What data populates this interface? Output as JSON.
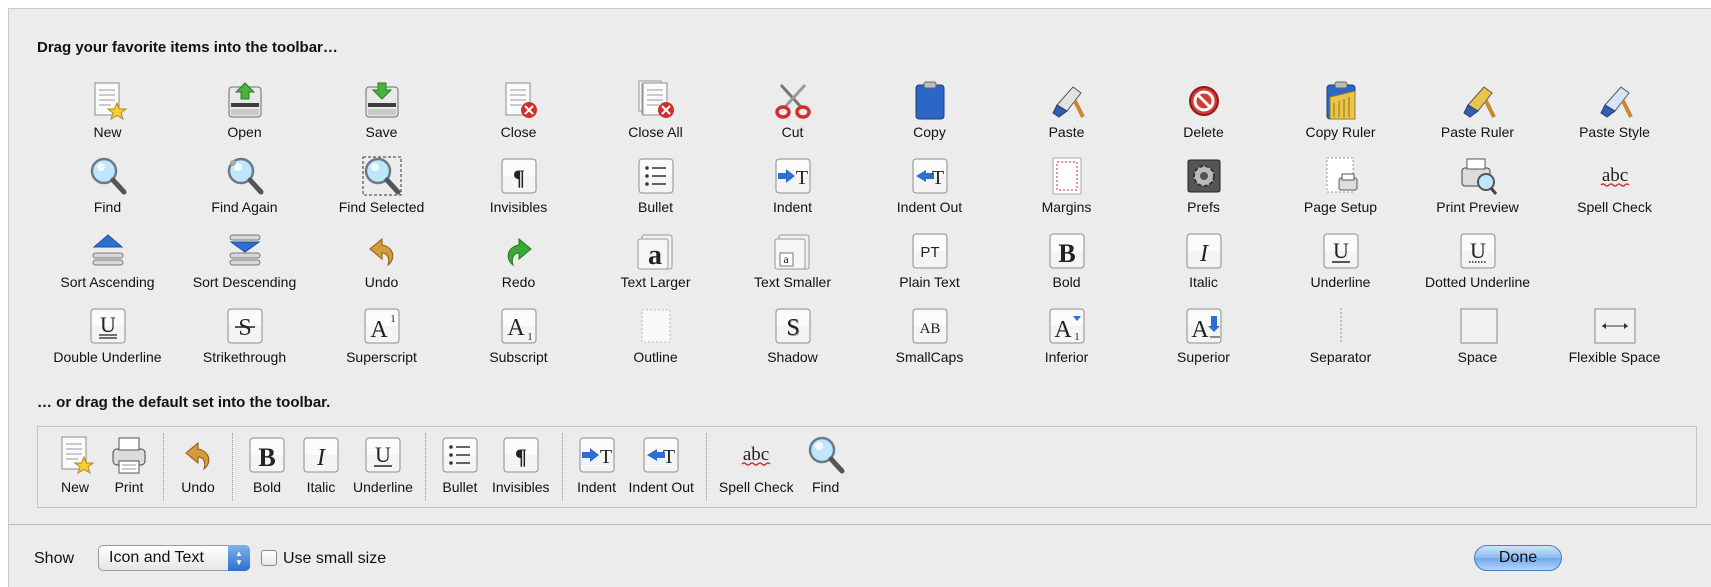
{
  "window": {
    "heading_items": "Drag your favorite items into the toolbar…",
    "heading_default": "… or drag the default set into the toolbar."
  },
  "items": [
    {
      "label": "New",
      "icon": "new-doc-icon"
    },
    {
      "label": "Open",
      "icon": "open-tray-icon"
    },
    {
      "label": "Save",
      "icon": "save-tray-icon"
    },
    {
      "label": "Close",
      "icon": "close-doc-icon"
    },
    {
      "label": "Close All",
      "icon": "close-all-icon"
    },
    {
      "label": "Cut",
      "icon": "scissors-icon"
    },
    {
      "label": "Copy",
      "icon": "clipboard-icon"
    },
    {
      "label": "Paste",
      "icon": "paste-brush-icon"
    },
    {
      "label": "Delete",
      "icon": "delete-icon"
    },
    {
      "label": "Copy Ruler",
      "icon": "copy-ruler-icon"
    },
    {
      "label": "Paste Ruler",
      "icon": "paste-ruler-icon"
    },
    {
      "label": "Paste Style",
      "icon": "paste-style-icon"
    },
    {
      "label": "Find",
      "icon": "magnifier-icon"
    },
    {
      "label": "Find Again",
      "icon": "find-again-icon"
    },
    {
      "label": "Find Selected",
      "icon": "find-selected-icon"
    },
    {
      "label": "Invisibles",
      "icon": "pilcrow-icon"
    },
    {
      "label": "Bullet",
      "icon": "bullet-list-icon"
    },
    {
      "label": "Indent",
      "icon": "indent-icon"
    },
    {
      "label": "Indent Out",
      "icon": "indent-out-icon"
    },
    {
      "label": "Margins",
      "icon": "margins-icon"
    },
    {
      "label": "Prefs",
      "icon": "prefs-icon"
    },
    {
      "label": "Page Setup",
      "icon": "page-setup-icon"
    },
    {
      "label": "Print Preview",
      "icon": "print-preview-icon"
    },
    {
      "label": "Spell Check",
      "icon": "spell-check-icon"
    },
    {
      "label": "Sort Ascending",
      "icon": "sort-ascending-icon"
    },
    {
      "label": "Sort Descending",
      "icon": "sort-descending-icon"
    },
    {
      "label": "Undo",
      "icon": "undo-icon"
    },
    {
      "label": "Redo",
      "icon": "redo-icon"
    },
    {
      "label": "Text Larger",
      "icon": "text-larger-icon"
    },
    {
      "label": "Text Smaller",
      "icon": "text-smaller-icon"
    },
    {
      "label": "Plain Text",
      "icon": "plain-text-icon"
    },
    {
      "label": "Bold",
      "icon": "bold-icon"
    },
    {
      "label": "Italic",
      "icon": "italic-icon"
    },
    {
      "label": "Underline",
      "icon": "underline-icon"
    },
    {
      "label": "Dotted Underline",
      "icon": "dotted-underline-icon"
    },
    {
      "label": "",
      "icon": "empty"
    },
    {
      "label": "Double Underline",
      "icon": "double-underline-icon"
    },
    {
      "label": "Strikethrough",
      "icon": "strikethrough-icon"
    },
    {
      "label": "Superscript",
      "icon": "superscript-icon"
    },
    {
      "label": "Subscript",
      "icon": "subscript-icon"
    },
    {
      "label": "Outline",
      "icon": "outline-icon"
    },
    {
      "label": "Shadow",
      "icon": "shadow-icon"
    },
    {
      "label": "SmallCaps",
      "icon": "smallcaps-icon"
    },
    {
      "label": "Inferior",
      "icon": "inferior-icon"
    },
    {
      "label": "Superior",
      "icon": "superior-icon"
    },
    {
      "label": "Separator",
      "icon": "separator-icon"
    },
    {
      "label": "Space",
      "icon": "space-icon"
    },
    {
      "label": "Flexible Space",
      "icon": "flexible-space-icon"
    }
  ],
  "default_set": [
    [
      {
        "label": "New",
        "icon": "new-doc-icon"
      },
      {
        "label": "Print",
        "icon": "printer-icon"
      }
    ],
    [
      {
        "label": "Undo",
        "icon": "undo-icon"
      }
    ],
    [
      {
        "label": "Bold",
        "icon": "bold-icon"
      },
      {
        "label": "Italic",
        "icon": "italic-icon"
      },
      {
        "label": "Underline",
        "icon": "underline-icon"
      }
    ],
    [
      {
        "label": "Bullet",
        "icon": "bullet-list-icon"
      },
      {
        "label": "Invisibles",
        "icon": "pilcrow-icon"
      }
    ],
    [
      {
        "label": "Indent",
        "icon": "indent-icon"
      },
      {
        "label": "Indent Out",
        "icon": "indent-out-icon"
      }
    ],
    [
      {
        "label": "Spell Check",
        "icon": "spell-check-icon"
      },
      {
        "label": "Find",
        "icon": "magnifier-icon"
      }
    ]
  ],
  "footer": {
    "show_label": "Show",
    "show_value": "Icon and Text",
    "small_size_label": "Use small size",
    "small_size_checked": false,
    "done_label": "Done"
  },
  "colors": {
    "accent_blue": "#2c6fd3",
    "delete_red": "#d0302a",
    "arrow_green": "#3aa832"
  }
}
